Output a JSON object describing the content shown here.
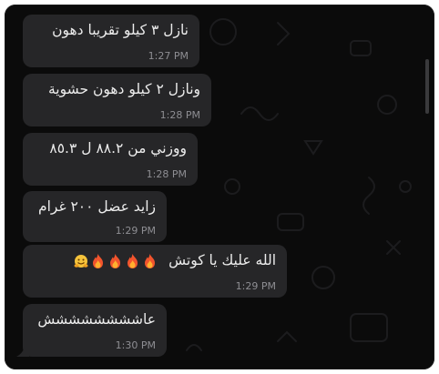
{
  "chat": {
    "messages": [
      {
        "text": "نازل ٣ كيلو تقريبا دهون",
        "time": "1:27 PM"
      },
      {
        "text": "ونازل ٢ كيلو دهون حشوية",
        "time": "1:28 PM"
      },
      {
        "text": "ووزني من ٨٨.٢ ل ٨٥.٣",
        "time": "1:28 PM"
      },
      {
        "text": "زايد عضل ٢٠٠ غرام",
        "time": "1:29 PM"
      },
      {
        "text": "الله عليك يا كوتش",
        "time": "1:29 PM",
        "emojis": [
          "fire-emoji",
          "fire-emoji",
          "fire-emoji",
          "fire-emoji",
          "hugging-face-emoji"
        ]
      },
      {
        "text": "عاشششششششش",
        "time": "1:30 PM"
      }
    ]
  },
  "colors": {
    "bubble": "#262628",
    "text": "#ececec",
    "time": "#8e8e93",
    "background": "#0b0b0b"
  }
}
